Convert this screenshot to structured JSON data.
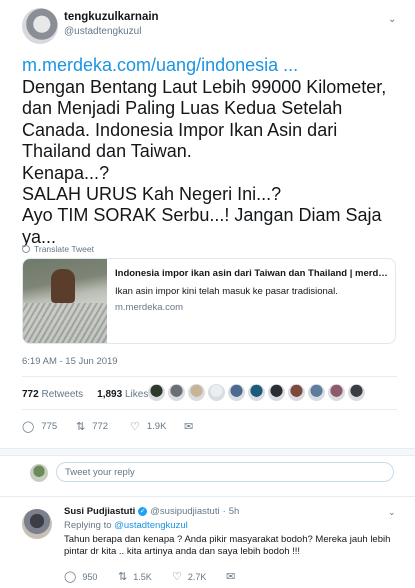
{
  "tweet": {
    "author_name": "tengkuzulkarnain",
    "author_handle": "@ustadtengkuzul",
    "link": "m.merdeka.com/uang/indonesia ...",
    "lines": [
      "Dengan Bentang Laut Lebih 99000 Kilometer,",
      "dan Menjadi Paling Luas Kedua Setelah",
      "Canada. Indonesia Impor Ikan Asin dari",
      "Thailand dan Taiwan.",
      "Kenapa...?",
      "SALAH URUS Kah Negeri Ini...?",
      "Ayo TIM SORAK Serbu...! Jangan Diam Saja",
      "ya..."
    ],
    "translate_label": "Translate Tweet",
    "card": {
      "title": "Indonesia impor ikan asin dari Taiwan dan Thailand | merde...",
      "description": "Ikan asin impor kini telah masuk ke pasar tradisional.",
      "domain": "m.merdeka.com"
    },
    "timestamp": "6:19 AM - 15 Jun 2019",
    "retweets_count": "772",
    "retweets_label": "Retweets",
    "likes_count": "1,893",
    "likes_label": "Likes",
    "actions": {
      "reply_count": "775",
      "retweet_count": "772",
      "like_count": "1.9K"
    }
  },
  "liker_colors": [
    "#2f3a2c",
    "#6b6f75",
    "#c7b59a",
    "#e9eef2",
    "#4d6a8f",
    "#1d5b7a",
    "#2b2e33",
    "#7c4b3d",
    "#5e7d9c",
    "#8f5a6e",
    "#3a3d44"
  ],
  "compose": {
    "placeholder": "Tweet your reply"
  },
  "reply": {
    "name": "Susi Pudjiastuti",
    "handle": "@susipudjiastuti",
    "time": "5h",
    "replying_label": "Replying to",
    "replying_handle": "@ustadtengkuzul",
    "text": "Tahun berapa dan kenapa ? Anda pikir masyarakat bodoh? Mereka jauh lebih pintar dr kita .. kita artinya anda dan saya lebih bodoh !!!",
    "reply_count": "950",
    "retweet_count": "1.5K",
    "like_count": "2.7K"
  },
  "colors": {
    "link": "#1b95e0",
    "muted": "#657786",
    "verified": "#1da1f2"
  }
}
